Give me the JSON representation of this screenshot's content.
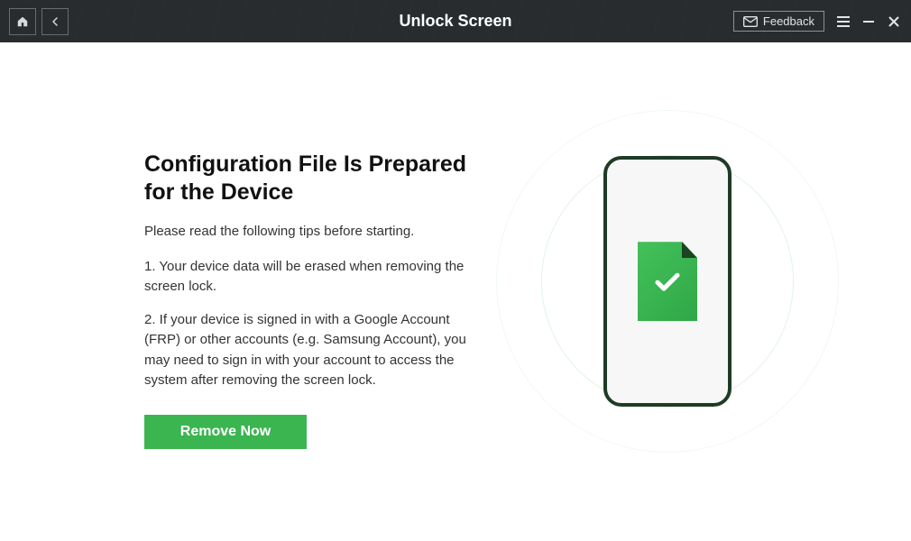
{
  "titlebar": {
    "title": "Unlock Screen",
    "feedback_label": "Feedback"
  },
  "content": {
    "heading": "Configuration File Is Prepared for the Device",
    "subtext": "Please read the following tips before starting.",
    "tip1": "1. Your device data will be erased when removing the screen lock.",
    "tip2": "2. If your device is signed in with a Google Account (FRP) or other accounts (e.g. Samsung Account), you may need to sign in with your account to access the system after removing the screen lock.",
    "primary_button": "Remove Now"
  },
  "colors": {
    "accent": "#3bb550",
    "titlebar_bg": "#282c2e"
  }
}
